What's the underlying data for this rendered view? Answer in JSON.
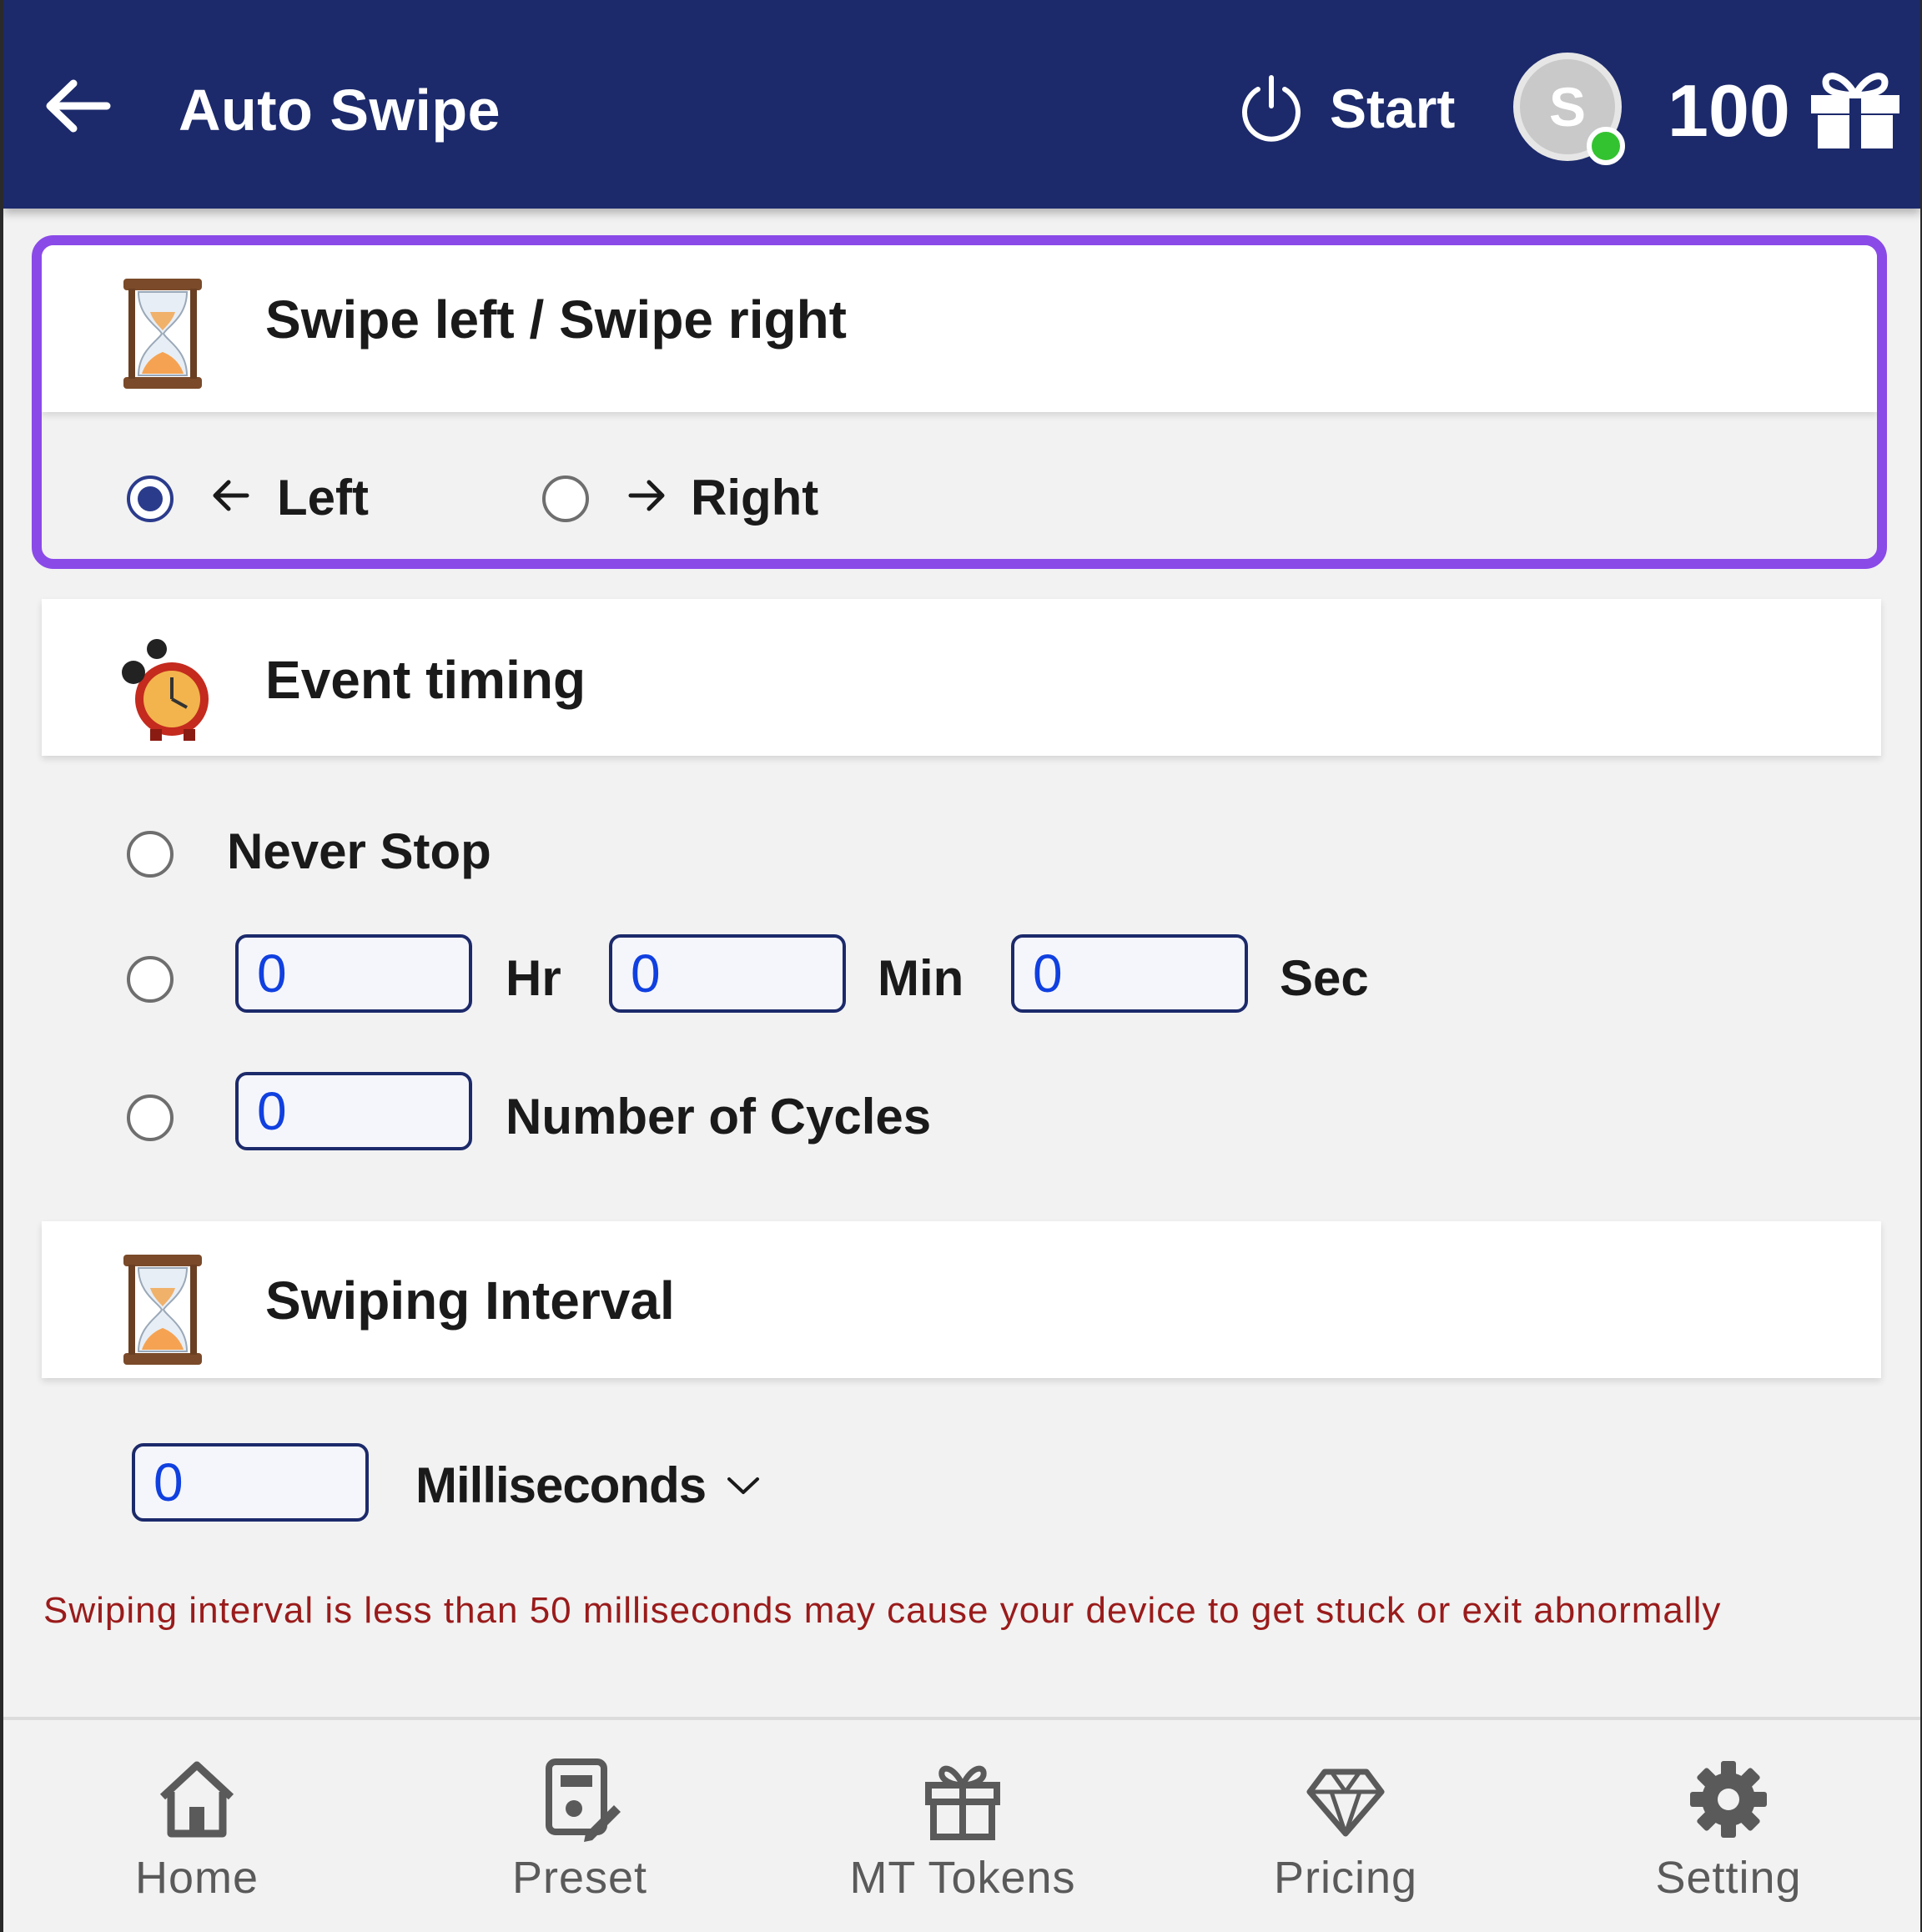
{
  "header": {
    "title": "Auto Swipe",
    "start_label": "Start",
    "avatar_letter": "S",
    "token_count": "100"
  },
  "swipe_direction": {
    "title": "Swipe left / Swipe right",
    "options": [
      {
        "label": "Left",
        "selected": true
      },
      {
        "label": "Right",
        "selected": false
      }
    ]
  },
  "event_timing": {
    "title": "Event timing",
    "never_stop_label": "Never Stop",
    "hours_value": "0",
    "hours_unit": "Hr",
    "minutes_value": "0",
    "minutes_unit": "Min",
    "seconds_value": "0",
    "seconds_unit": "Sec",
    "cycles_value": "0",
    "cycles_label": "Number of Cycles"
  },
  "swiping_interval": {
    "title": "Swiping Interval",
    "value": "0",
    "unit_selected": "Milliseconds",
    "warning": "Swiping interval is less than 50 milliseconds may cause your device to get stuck or exit abnormally"
  },
  "bottom_nav": {
    "items": [
      {
        "label": "Home",
        "icon": "home-icon"
      },
      {
        "label": "Preset",
        "icon": "preset-icon"
      },
      {
        "label": "MT Tokens",
        "icon": "gift-icon"
      },
      {
        "label": "Pricing",
        "icon": "diamond-icon"
      },
      {
        "label": "Setting",
        "icon": "gear-icon"
      }
    ]
  },
  "colors": {
    "header_bg": "#1c2a6b",
    "accent_border": "#8a4ae8",
    "input_text": "#1040e0",
    "warning_text": "#9a1b1b",
    "online_dot": "#34c330"
  }
}
